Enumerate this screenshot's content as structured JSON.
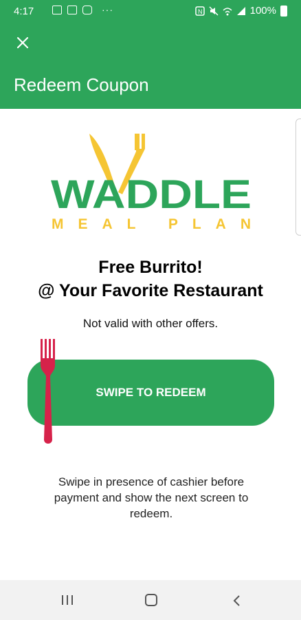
{
  "status_bar": {
    "time": "4:17",
    "battery": "100%",
    "overflow": "···"
  },
  "app_bar": {
    "title": "Redeem Coupon"
  },
  "logo": {
    "wordmark": "WADDLE",
    "tagline": "MEAL PLAN"
  },
  "coupon": {
    "title_line1": "Free Burrito!",
    "title_line2": "@ Your Favorite Restaurant",
    "subtitle": "Not valid with other offers."
  },
  "swipe": {
    "label": "SWIPE TO REDEEM"
  },
  "instructions": "Swipe in presence of cashier before payment and show the next screen to redeem.",
  "colors": {
    "brand_green": "#2da55a",
    "logo_yellow": "#f5c533",
    "fork_red": "#d6224a"
  },
  "nav": {
    "recent_icon": "recent-apps-icon",
    "home_icon": "home-icon",
    "back_icon": "back-icon"
  }
}
